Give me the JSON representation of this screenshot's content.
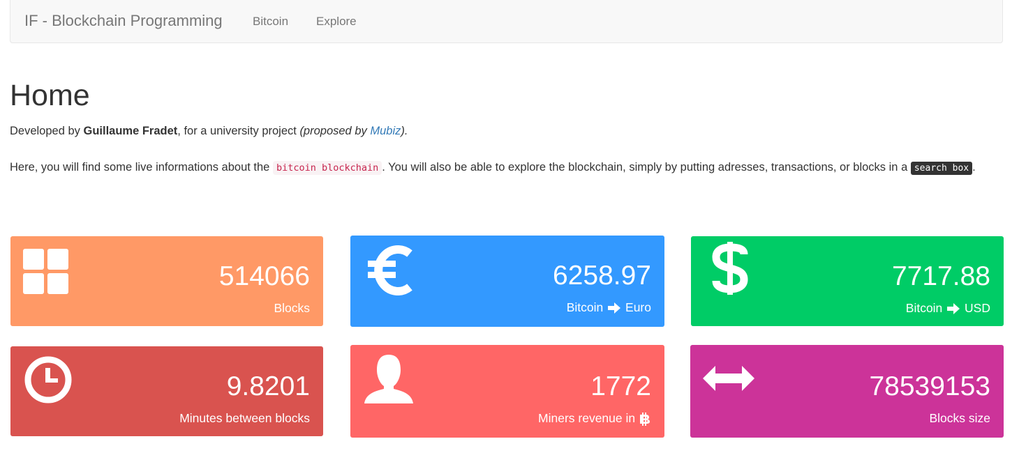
{
  "navbar": {
    "brand": "IF - Blockchain Programming",
    "links": [
      "Bitcoin",
      "Explore"
    ]
  },
  "page": {
    "title": "Home",
    "intro": {
      "prefix": "Developed by ",
      "author": "Guillaume Fradet",
      "middle": ", for a university project ",
      "proposed_prefix": "(proposed by ",
      "proposer": "Mubiz",
      "proposed_suffix": ").",
      "end": ""
    },
    "description": {
      "part1": "Here, you will find some live informations about the ",
      "code1": "bitcoin blockchain",
      "part2": ". You will also be able to explore the blockchain, simply by putting adresses, transactions, or blocks in a ",
      "code2": "search box",
      "part3": "."
    }
  },
  "tiles": [
    {
      "value": "514066",
      "label": "Blocks",
      "color": "#ff9966",
      "icon": "grid-icon"
    },
    {
      "value": "6258.97",
      "label_from": "Bitcoin",
      "label_to": "Euro",
      "color": "#3399ff",
      "icon": "euro-icon"
    },
    {
      "value": "7717.88",
      "label_from": "Bitcoin",
      "label_to": "USD",
      "color": "#00cc66",
      "icon": "dollar-icon"
    },
    {
      "value": "9.8201",
      "label": "Minutes between blocks",
      "color": "#d9534f",
      "icon": "clock-icon"
    },
    {
      "value": "1772",
      "label": "Miners revenue in",
      "color": "#ff6666",
      "icon": "user-icon"
    },
    {
      "value": "78539153",
      "label": "Blocks size",
      "color": "#cc3399",
      "icon": "arrows-horizontal-icon"
    }
  ]
}
